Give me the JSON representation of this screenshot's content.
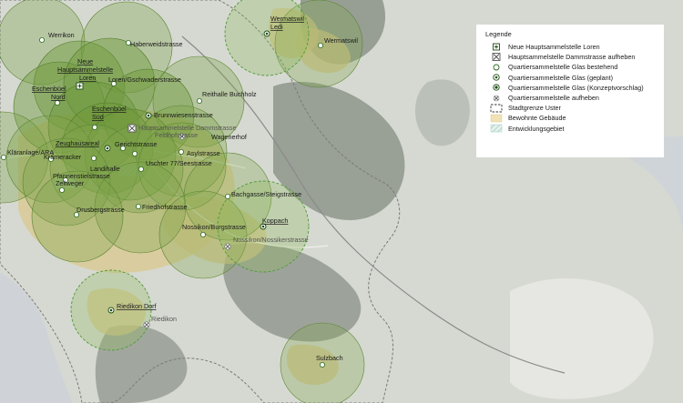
{
  "legend": {
    "title": "Legende",
    "items": [
      {
        "label": "Neue Hauptsammelstelle Loren",
        "icon": "new-main-station-icon"
      },
      {
        "label": "Hauptsammelstelle Dammstrasse aufheben",
        "icon": "remove-main-station-icon"
      },
      {
        "label": "Quartiersammelstelle Glas bestehend",
        "icon": "existing-station-icon"
      },
      {
        "label": "Quartiersammelstelle Glas (geplant)",
        "icon": "planned-station-icon"
      },
      {
        "label": "Quartiersammelstelle Glas (Konzeptvorschlag)",
        "icon": "concept-station-icon"
      },
      {
        "label": "Quartiersammelstelle aufheben",
        "icon": "remove-station-icon"
      },
      {
        "label": "Stadtgrenze Uster",
        "icon": "city-boundary-icon"
      },
      {
        "label": "Bewohnte Gebäude",
        "icon": "inhabited-buildings-icon"
      },
      {
        "label": "Entwicklungsgebiet",
        "icon": "development-area-icon"
      }
    ]
  },
  "map": {
    "labels": {
      "werrikon": "Werrikon",
      "haberweid": "Haberweidstrasse",
      "wermatswil_ledi_1": "Wermatswil",
      "wermatswil_ledi_2": "Ledi",
      "wermatswil": "Wermatswil",
      "neue_hs_1": "Neue",
      "neue_hs_2": "Hauptsammelstelle",
      "neue_hs_3": "Loren",
      "eschenbuel_nord_1": "Eschenbüel",
      "eschenbuel_nord_2": "Nord",
      "loren_gschwader": "Loren/Gschwaderstrasse",
      "reithalle": "Reithalle Buchholz",
      "eschenbuel_sued_1": "Eschenbüel",
      "eschenbuel_sued_2": "Süd",
      "brunnwiesen": "Brunnwiesenstrasse",
      "hs_damm": "Hauptsammelstelle Dammstrasse",
      "feldhof": "Feldhofstrasse",
      "wagenerhof": "Wagenerhof",
      "zeughaus": "Zeughausareal",
      "gerichts": "Gerichtstrasse",
      "klaeranlage": "Kläranlage/ARA",
      "asyl": "Asylstrasse",
      "kraemeracker": "Krämeracker",
      "uschter": "Uschter 77/Seestrasse",
      "landihalle": "Landihalle",
      "pfannenstiel": "Pfannenstielstrasse",
      "zellweger": "Zellweger",
      "bachgasse": "Bachgasse/Steigstrasse",
      "friedhof": "Friedhofstrasse",
      "drusberg": "Drusbergstrasse",
      "nossikon_burg": "Nossikon/Burgstrasse",
      "koppach": "Koppach",
      "nossikon_nossiker": "Nossikon/Nossikerstrasse",
      "riedikon_dorf": "Riedikon Dorf",
      "riedikon": "Riedikon",
      "sulzbach": "Sulzbach"
    }
  },
  "colors": {
    "circle_fill": "#6f9a3c",
    "circle_stroke": "#4f7a2a",
    "dashed_circle": "#4f9a3a",
    "buildings": "#d8c78a",
    "water": "#d7dbdf",
    "forest": "#8c938a"
  }
}
